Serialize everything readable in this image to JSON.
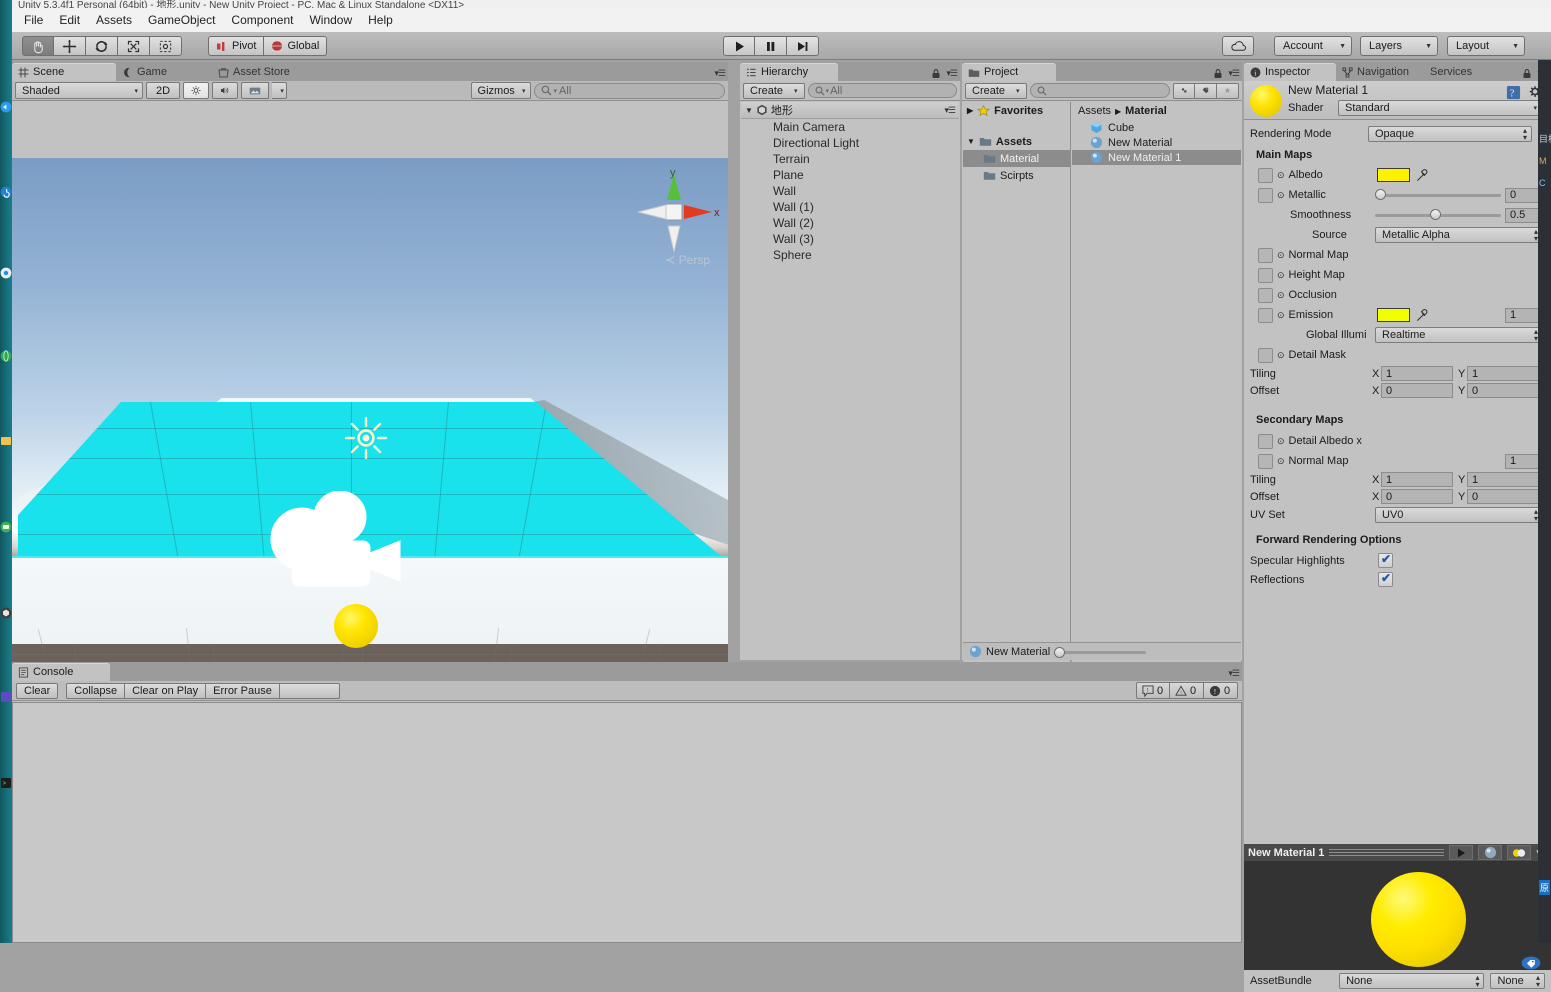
{
  "window": {
    "title_sliver": "Unity 5.3.4f1 Personal (64bit) - 地形.unity - New Unity Project - PC, Mac & Linux Standalone <DX11>"
  },
  "menubar": {
    "items": [
      "File",
      "Edit",
      "Assets",
      "GameObject",
      "Component",
      "Window",
      "Help"
    ]
  },
  "toolbar": {
    "tools": [
      {
        "name": "hand-tool",
        "glyph": "✋",
        "active": true
      },
      {
        "name": "move-tool",
        "glyph": "✥",
        "active": false
      },
      {
        "name": "rotate-tool",
        "glyph": "⟳",
        "active": false
      },
      {
        "name": "scale-tool",
        "glyph": "⤡",
        "active": false
      },
      {
        "name": "rect-tool",
        "glyph": "▣",
        "active": false
      }
    ],
    "pivot_label": "Pivot",
    "space_label": "Global",
    "play_label": "▶",
    "pause_label": "❚❚",
    "step_label": "▶❙",
    "cloud_label": "☁",
    "account_label": "Account",
    "layers_label": "Layers",
    "layout_label": "Layout"
  },
  "scene": {
    "tabs": [
      {
        "label": "Scene",
        "icon": "grid-icon",
        "active": true
      },
      {
        "label": "Game",
        "icon": "gamepad-icon",
        "active": false
      },
      {
        "label": "Asset Store",
        "icon": "store-icon",
        "active": false
      }
    ],
    "draw_mode": "Shaded",
    "mode_2d": "2D",
    "gizmos_label": "Gizmos",
    "search_placeholder": "All",
    "axis": {
      "y": "y",
      "x": "x"
    },
    "perspective_label": "Persp",
    "objects": [
      "Main Camera gizmo",
      "Directional Light gizmo",
      "Sphere",
      "Plane",
      "Walls"
    ]
  },
  "console": {
    "tab_label": "Console",
    "buttons": [
      "Clear",
      "Collapse",
      "Clear on Play",
      "Error Pause"
    ],
    "stats": {
      "info": "0",
      "warning": "0",
      "error": "0"
    }
  },
  "hierarchy": {
    "tab_label": "Hierarchy",
    "create_label": "Create",
    "search_placeholder": "All",
    "scene_name": "地形",
    "items": [
      "Main Camera",
      "Directional Light",
      "Terrain",
      "Plane",
      "Wall",
      "Wall (1)",
      "Wall (2)",
      "Wall (3)",
      "Sphere"
    ]
  },
  "project": {
    "tab_label": "Project",
    "create_label": "Create",
    "search_placeholder": "",
    "favorites_label": "Favorites",
    "assets_label": "Assets",
    "folders": [
      {
        "label": "Material",
        "selected": true
      },
      {
        "label": "Scirpts",
        "selected": false
      }
    ],
    "breadcrumb": [
      "Assets",
      "Material"
    ],
    "assets": [
      {
        "label": "Cube",
        "icon": "cube-icon",
        "selected": false
      },
      {
        "label": "New Material",
        "icon": "material-icon",
        "selected": false
      },
      {
        "label": "New Material 1",
        "icon": "material-icon",
        "selected": true
      }
    ],
    "footer_label": "New Material"
  },
  "inspector": {
    "tabs": [
      {
        "label": "Inspector",
        "active": true
      },
      {
        "label": "Navigation",
        "active": false
      },
      {
        "label": "Services",
        "active": false
      }
    ],
    "material_name": "New Material 1",
    "shader_label": "Shader",
    "shader_value": "Standard",
    "rendering_mode_label": "Rendering Mode",
    "rendering_mode_value": "Opaque",
    "main_maps_header": "Main Maps",
    "albedo_label": "Albedo",
    "albedo_color": "#fff200",
    "metallic_label": "Metallic",
    "metallic_value": "0",
    "smoothness_label": "Smoothness",
    "smoothness_value": "0.5",
    "source_label": "Source",
    "source_value": "Metallic Alpha",
    "normal_map_label": "Normal Map",
    "height_map_label": "Height Map",
    "occlusion_label": "Occlusion",
    "emission_label": "Emission",
    "emission_color": "#f3ff00",
    "emission_value": "1",
    "global_illum_label": "Global Illumi",
    "global_illum_value": "Realtime",
    "detail_mask_label": "Detail Mask",
    "tiling_label": "Tiling",
    "offset_label": "Offset",
    "tiling_x": "1",
    "tiling_y": "1",
    "offset_x": "0",
    "offset_y": "0",
    "secondary_maps_header": "Secondary Maps",
    "detail_albedo_label": "Detail Albedo x",
    "sec_normal_map_label": "Normal Map",
    "sec_normal_value": "1",
    "sec_tiling_x": "1",
    "sec_tiling_y": "1",
    "sec_offset_x": "0",
    "sec_offset_y": "0",
    "uv_set_label": "UV Set",
    "uv_set_value": "UV0",
    "forward_header": "Forward Rendering Options",
    "specular_label": "Specular Highlights",
    "specular_checked": true,
    "reflections_label": "Reflections",
    "reflections_checked": true,
    "axis_x": "X",
    "axis_y": "Y",
    "preview_title": "New Material 1",
    "assetbundle_label": "AssetBundle",
    "assetbundle_value": "None",
    "assetbundle_variant": "None"
  },
  "colors": {
    "accent_cyan": "#1ae2ec",
    "material_yellow": "#ffe500",
    "panel_gray": "#c2c2c2",
    "chrome_gray": "#a2a2a2",
    "dock_teal": "#16707c"
  }
}
